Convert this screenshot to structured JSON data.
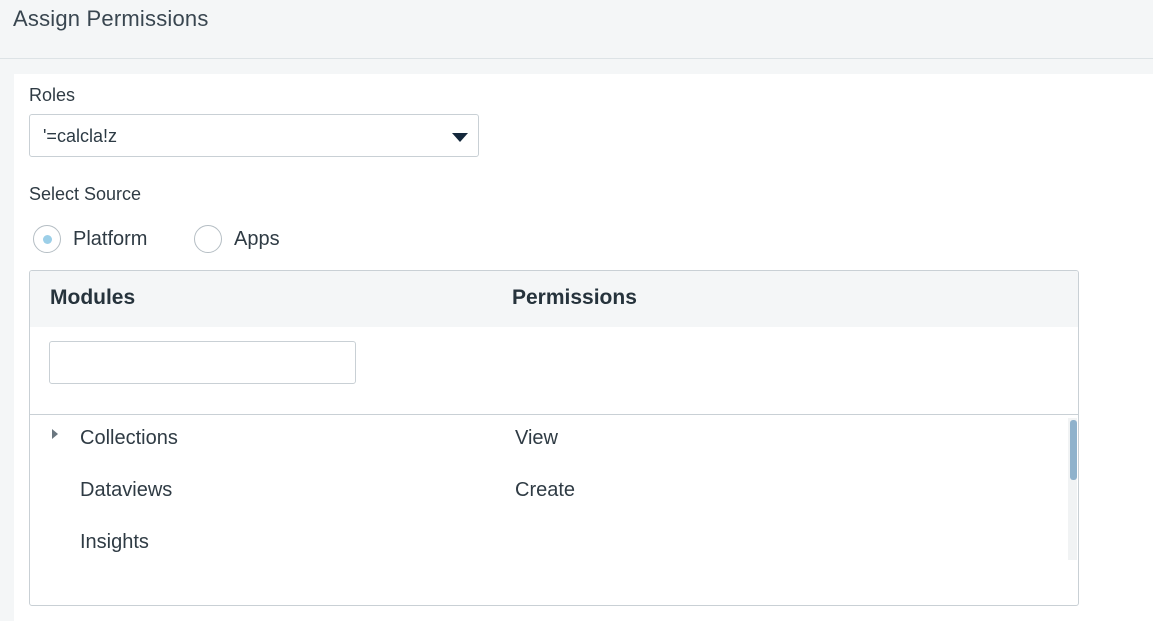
{
  "header": {
    "title": "Assign Permissions"
  },
  "roles": {
    "label": "Roles",
    "selected": "'=calcla!z"
  },
  "source": {
    "label": "Select Source",
    "options": [
      {
        "label": "Platform",
        "checked": true
      },
      {
        "label": "Apps",
        "checked": false
      }
    ]
  },
  "table": {
    "headers": {
      "modules": "Modules",
      "permissions": "Permissions"
    },
    "filter": {
      "value": "",
      "placeholder": ""
    },
    "modules": [
      {
        "name": "Collections",
        "expandable": true,
        "icon": "caret-right-icon"
      },
      {
        "name": "Dataviews",
        "expandable": false
      },
      {
        "name": "Insights",
        "expandable": false
      }
    ],
    "permissions": [
      "View",
      "Create"
    ]
  },
  "icons": {
    "dropdown": "chevron-down-icon",
    "expand": "caret-right-icon"
  },
  "colors": {
    "accent": "#9ccfe8",
    "header_bg": "#f4f6f7",
    "border": "#c9d0d5",
    "scroll_thumb": "#8fb2cc",
    "caret": "#14283b"
  }
}
